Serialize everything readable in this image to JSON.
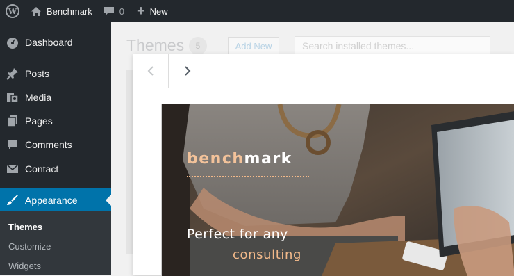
{
  "admin_bar": {
    "site_name": "Benchmark",
    "comments_count": "0",
    "new_label": "New"
  },
  "sidebar": {
    "items": [
      {
        "label": "Dashboard",
        "icon": "dashboard-icon"
      },
      {
        "label": "Posts",
        "icon": "pin-icon"
      },
      {
        "label": "Media",
        "icon": "media-icon"
      },
      {
        "label": "Pages",
        "icon": "pages-icon"
      },
      {
        "label": "Comments",
        "icon": "comment-icon"
      },
      {
        "label": "Contact",
        "icon": "mail-icon"
      },
      {
        "label": "Appearance",
        "icon": "brush-icon",
        "current": true
      }
    ],
    "submenu": [
      {
        "label": "Themes",
        "active": true
      },
      {
        "label": "Customize"
      },
      {
        "label": "Widgets"
      }
    ]
  },
  "themes_page": {
    "title": "Themes",
    "count": "5",
    "add_new": "Add New",
    "search_placeholder": "Search installed themes..."
  },
  "preview": {
    "brand_part1": "bench",
    "brand_part2": "mark",
    "headline_line1": "Perfect for any",
    "headline_line2": "consulting"
  },
  "colors": {
    "admin_bar": "#23282d",
    "accent": "#0073aa",
    "brand_orange": "#f2b98a"
  }
}
